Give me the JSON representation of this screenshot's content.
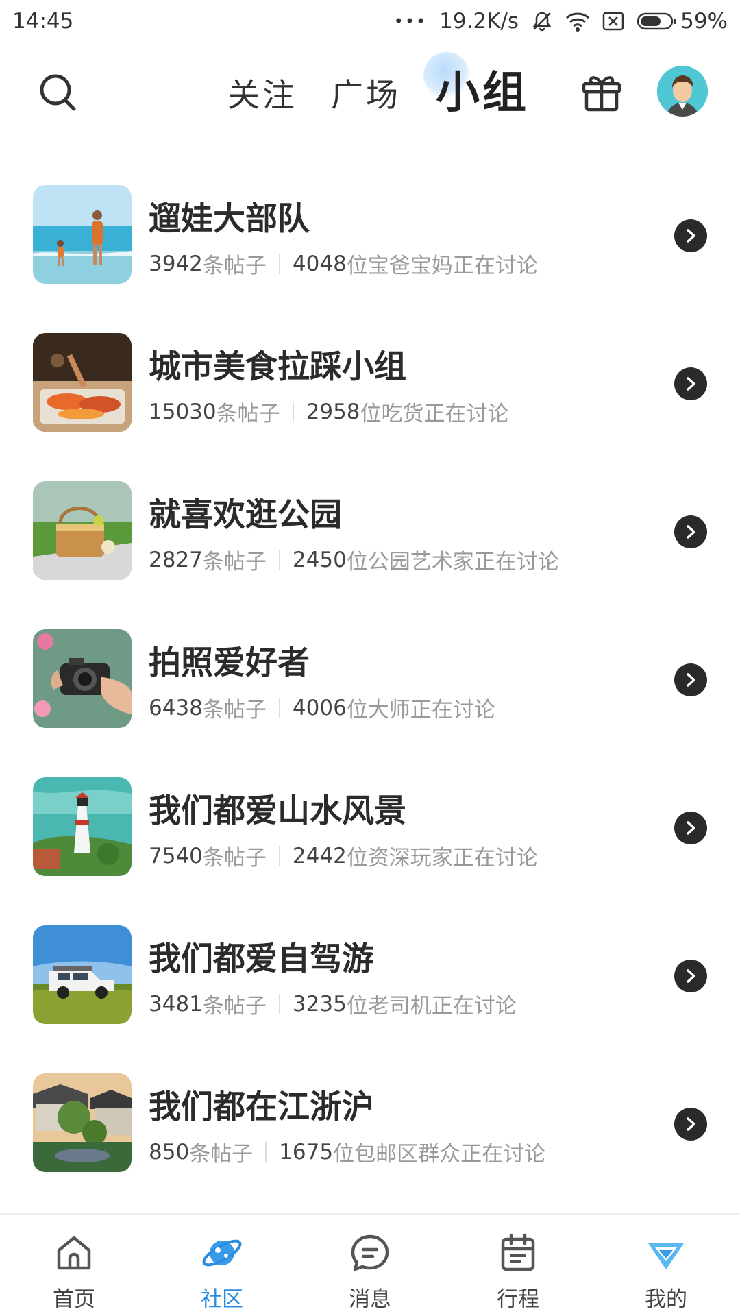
{
  "status_bar": {
    "time": "14:45",
    "dots": "•••",
    "speed": "19.2K/s",
    "battery": "59%"
  },
  "header": {
    "tabs": [
      {
        "label": "关注"
      },
      {
        "label": "广场"
      },
      {
        "label": "小组",
        "active": true
      }
    ],
    "icons": [
      "search-icon",
      "gift-icon",
      "avatar"
    ]
  },
  "groups": [
    {
      "name": "遛娃大部队",
      "posts": "3942",
      "posts_unit": "条帖子",
      "members": "4048",
      "members_text": "位宝爸宝妈正在讨论"
    },
    {
      "name": "城市美食拉踩小组",
      "posts": "15030",
      "posts_unit": "条帖子",
      "members": "2958",
      "members_text": "位吃货正在讨论"
    },
    {
      "name": "就喜欢逛公园",
      "posts": "2827",
      "posts_unit": "条帖子",
      "members": "2450",
      "members_text": "位公园艺术家正在讨论"
    },
    {
      "name": "拍照爱好者",
      "posts": "6438",
      "posts_unit": "条帖子",
      "members": "4006",
      "members_text": "位大师正在讨论"
    },
    {
      "name": "我们都爱山水风景",
      "posts": "7540",
      "posts_unit": "条帖子",
      "members": "2442",
      "members_text": "位资深玩家正在讨论"
    },
    {
      "name": "我们都爱自驾游",
      "posts": "3481",
      "posts_unit": "条帖子",
      "members": "3235",
      "members_text": "位老司机正在讨论"
    },
    {
      "name": "我们都在江浙沪",
      "posts": "850",
      "posts_unit": "条帖子",
      "members": "1675",
      "members_text": "位包邮区群众正在讨论"
    }
  ],
  "bottom_nav": [
    {
      "label": "首页",
      "icon": "home-icon"
    },
    {
      "label": "社区",
      "icon": "planet-icon",
      "active": true
    },
    {
      "label": "消息",
      "icon": "message-icon"
    },
    {
      "label": "行程",
      "icon": "calendar-icon"
    },
    {
      "label": "我的",
      "icon": "diamond-icon"
    }
  ],
  "colors": {
    "accent": "#2a8de0",
    "text_primary": "#2b2b2b",
    "text_secondary": "#999999",
    "arrow_bg": "#2a2a2a"
  }
}
